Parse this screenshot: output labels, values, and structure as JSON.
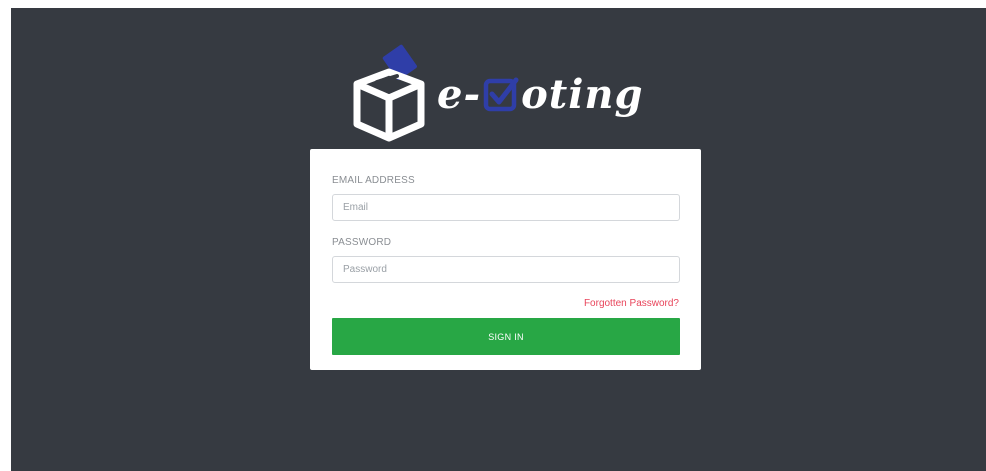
{
  "logo": {
    "text_prefix": "e-",
    "text_suffix": "oting",
    "box_icon": "ballot-box-icon",
    "check_icon": "checkbox-check-icon",
    "accent_color": "#2f3ea8"
  },
  "form": {
    "email_label": "EMAIL ADDRESS",
    "email_placeholder": "Email",
    "password_label": "PASSWORD",
    "password_placeholder": "Password",
    "forgot_link": "Forgotten Password?",
    "signin_label": "SIGN IN"
  },
  "colors": {
    "background": "#363a41",
    "button": "#28a745",
    "link": "#e8445a"
  }
}
